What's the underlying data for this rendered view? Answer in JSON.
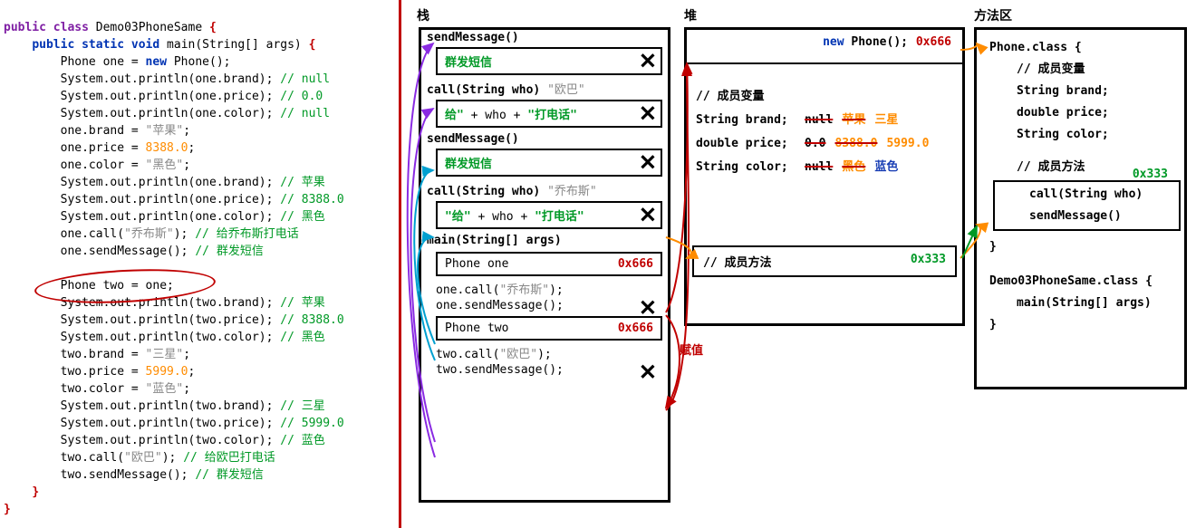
{
  "code": {
    "class_decl_kw1": "public",
    "class_decl_kw2": "class",
    "class_name": "Demo03PhoneSame",
    "main_kw1": "public",
    "main_kw2": "static",
    "main_kw3": "void",
    "main_sig": "main(String[] args)",
    "l3_a": "Phone one = ",
    "l3_new": "new",
    "l3_b": " Phone();",
    "l4": "System.out.println(one.brand); ",
    "l4c": "// null",
    "l5": "System.out.println(one.price); ",
    "l5c": "// 0.0",
    "l6": "System.out.println(one.color); ",
    "l6c": "// null",
    "l7a": "one.brand = ",
    "l7s": "\"苹果\"",
    "l7b": ";",
    "l8a": "one.price = ",
    "l8n": "8388.0",
    "l8b": ";",
    "l9a": "one.color = ",
    "l9s": "\"黑色\"",
    "l9b": ";",
    "l10": "System.out.println(one.brand); ",
    "l10c": "// 苹果",
    "l11": "System.out.println(one.price); ",
    "l11c": "// 8388.0",
    "l12": "System.out.println(one.color); ",
    "l12c": "// 黑色",
    "l13a": "one.call(",
    "l13s": "\"乔布斯\"",
    "l13b": "); ",
    "l13c": "// 给乔布斯打电话",
    "l14": "one.sendMessage(); ",
    "l14c": "// 群发短信",
    "l15": "Phone two = one;",
    "l16": "System.out.println(two.brand); ",
    "l16c": "// 苹果",
    "l17": "System.out.println(two.price); ",
    "l17c": "// 8388.0",
    "l18": "System.out.println(two.color); ",
    "l18c": "// 黑色",
    "l19a": "two.brand = ",
    "l19s": "\"三星\"",
    "l19b": ";",
    "l20a": "two.price = ",
    "l20n": "5999.0",
    "l20b": ";",
    "l21a": "two.color = ",
    "l21s": "\"蓝色\"",
    "l21b": ";",
    "l22": "System.out.println(two.brand); ",
    "l22c": "// 三星",
    "l23": "System.out.println(two.price); ",
    "l23c": "// 5999.0",
    "l24": "System.out.println(two.color); ",
    "l24c": "// 蓝色",
    "l25a": "two.call(",
    "l25s": "\"欧巴\"",
    "l25b": "); ",
    "l25c": "// 给欧巴打电话",
    "l26": "two.sendMessage(); ",
    "l26c": "// 群发短信"
  },
  "cols": {
    "stack": "栈",
    "heap": "堆",
    "method": "方法区"
  },
  "stack": {
    "r1": "sendMessage()",
    "s1": "群发短信",
    "r2": "call(String who)",
    "r2_arg": "\"欧巴\"",
    "s2a": "给\"",
    "s2b": " + who + ",
    "s2c": "\"打电话\"",
    "r3": "sendMessage()",
    "s3": "群发短信",
    "r4": "call(String who)",
    "r4_arg": "\"乔布斯\"",
    "s4a": "\"给\"",
    "s4b": " + who + ",
    "s4c": "\"打电话\"",
    "r5": "main(String[] args)",
    "var1": "Phone one",
    "addr1": "0x666",
    "c1a": "one.call(",
    "c1s": "\"乔布斯\"",
    "c1b": ");",
    "c2": "one.sendMessage();",
    "var2": "Phone two",
    "addr2": "0x666",
    "c3a": "two.call(",
    "c3s": "\"欧巴\"",
    "c3b": ");",
    "c4": "two.sendMessage();"
  },
  "heap": {
    "new_kw": "new",
    "new_rest": " Phone();",
    "addr": "0x666",
    "member_title": "// 成员变量",
    "row1_label": "String brand;",
    "row1_v1": "null",
    "row1_v2": "苹果",
    "row1_v3": "三星",
    "row2_label": "double price;",
    "row2_v1": "0.0",
    "row2_v2": "8388.0",
    "row2_v3": "5999.0",
    "row3_label": "String color;",
    "row3_v1": "null",
    "row3_v2": "黑色",
    "row3_v3": "蓝色",
    "method_title": "// 成员方法",
    "method_addr": "0x333",
    "assign": "赋值"
  },
  "method": {
    "cls1": "Phone.class {",
    "cls1_c1": "// 成员变量",
    "cls1_f1": "String brand;",
    "cls1_f2": "double price;",
    "cls1_f3": "String color;",
    "cls1_c2": "// 成员方法",
    "cls1_m1": "call(String who)",
    "cls1_m2": "sendMessage()",
    "addr": "0x333",
    "brace1": "}",
    "cls2": "Demo03PhoneSame.class {",
    "cls2_m1": "main(String[] args)",
    "brace2": "}"
  }
}
